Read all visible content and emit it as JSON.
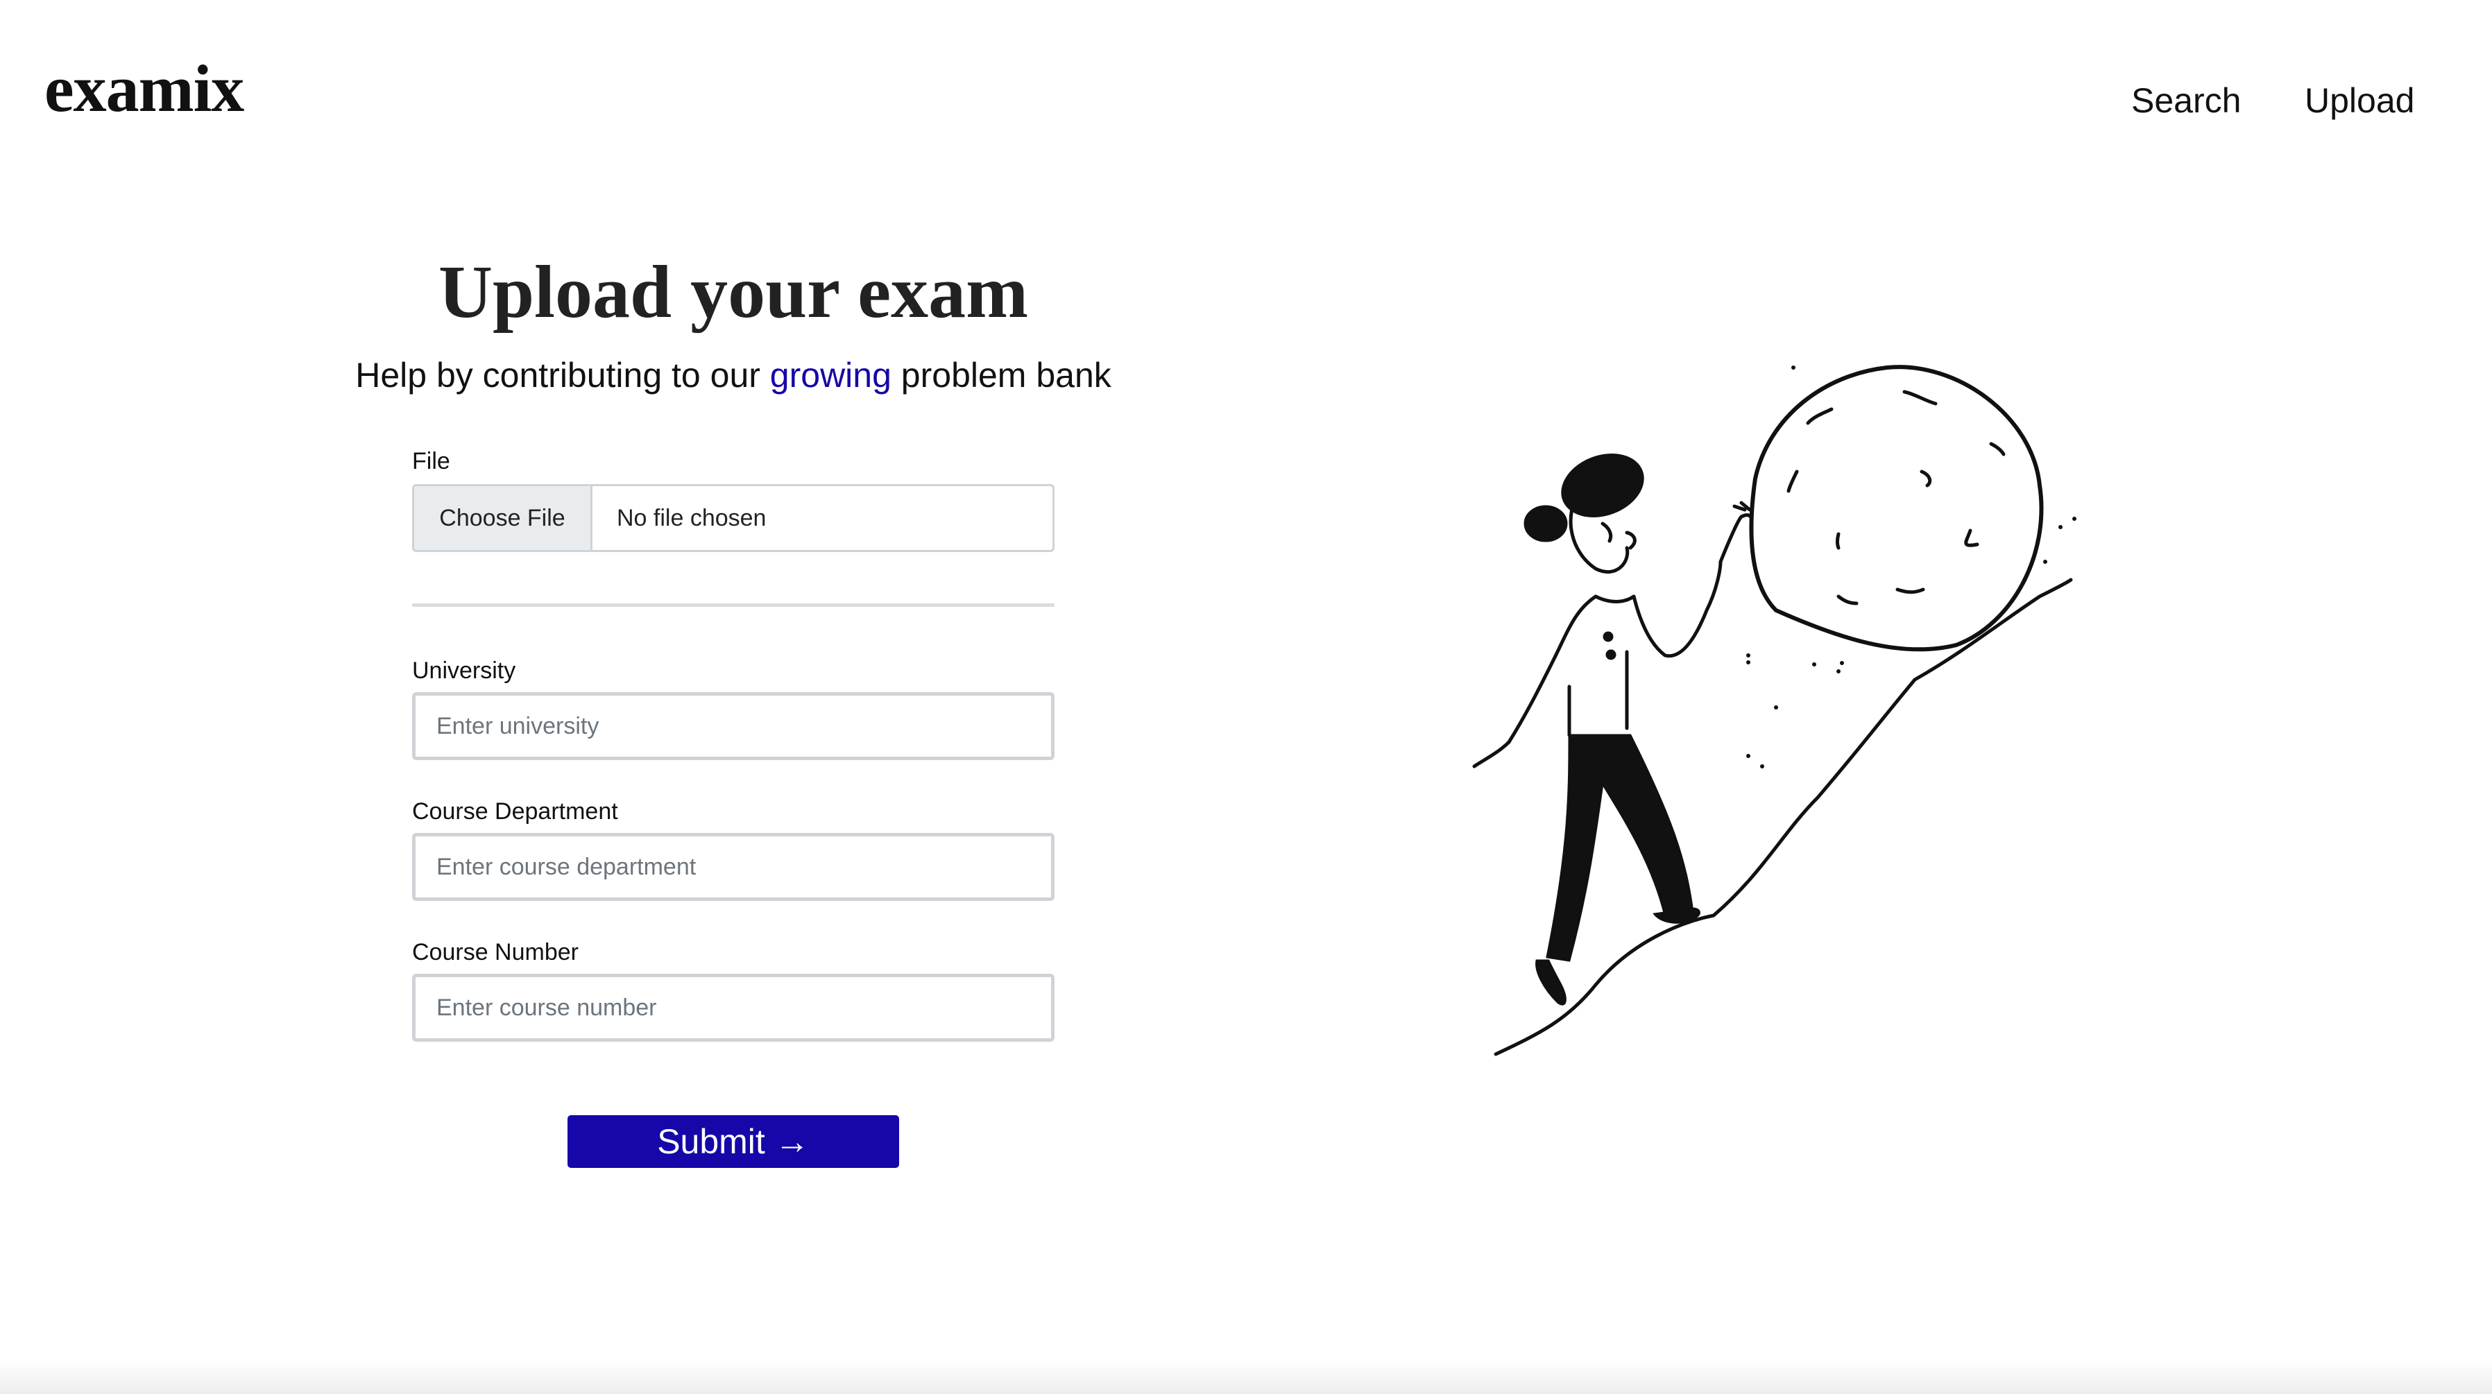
{
  "header": {
    "logo": "examix",
    "nav": [
      {
        "label": "Search"
      },
      {
        "label": "Upload"
      }
    ]
  },
  "main": {
    "title": "Upload your exam",
    "subtitle_before": "Help by contributing to our ",
    "subtitle_highlight": "growing",
    "subtitle_after": " problem bank"
  },
  "form": {
    "file": {
      "label": "File",
      "button_label": "Choose File",
      "status": "No file chosen"
    },
    "university": {
      "label": "University",
      "placeholder": "Enter university",
      "value": ""
    },
    "department": {
      "label": "Course Department",
      "placeholder": "Enter course department",
      "value": ""
    },
    "course_number": {
      "label": "Course Number",
      "placeholder": "Enter course number",
      "value": ""
    },
    "submit": {
      "label": "Submit",
      "icon": "arrow-right-icon",
      "glyph": "→"
    }
  },
  "illustration": {
    "icon": "person-pushing-boulder-illustration"
  },
  "colors": {
    "accent": "#1507a8",
    "text": "#111111",
    "input_border": "#cfd3d7",
    "background": "#ffffff"
  }
}
